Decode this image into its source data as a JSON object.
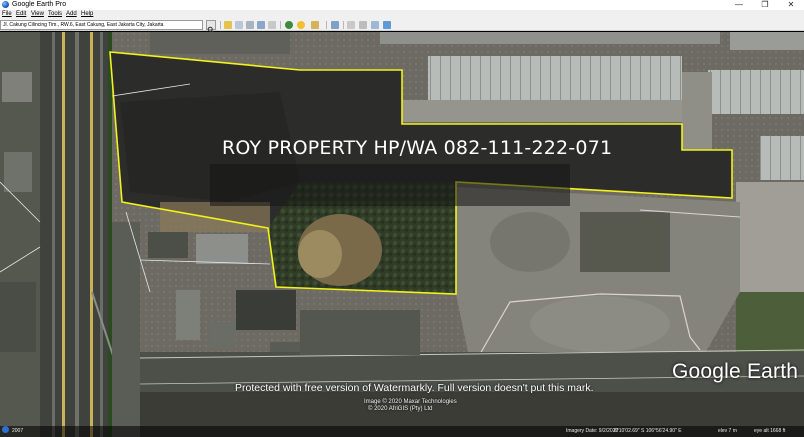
{
  "window": {
    "title": "Google Earth Pro",
    "minimize_glyph": "—",
    "maximize_glyph": "❐",
    "close_glyph": "✕"
  },
  "menu": {
    "items": [
      "File",
      "Edit",
      "View",
      "Tools",
      "Add",
      "Help"
    ]
  },
  "search": {
    "value": "Jl. Cakung Cilincing Tim., RW.6, East Cakung, East Jakarta City, Jakarta"
  },
  "toolbar": {
    "icons": [
      "search-icon",
      "sidebar-icon",
      "placemark-icon",
      "polygon-icon",
      "path-icon",
      "overlay-icon",
      "record-tour-icon",
      "historical-imagery-icon",
      "sun-icon",
      "planets-icon",
      "ruler-icon",
      "email-icon",
      "print-icon",
      "save-image-icon",
      "maps-icon"
    ]
  },
  "map": {
    "overlay_text": "ROY PROPERTY HP/WA 082-111-222-071",
    "boundary_color": "#f2f21c",
    "copyright_lines": [
      "Image © 2020 Maxar Technologies",
      "© 2020 AfriGIS (Pty) Ltd"
    ],
    "free_version_note": "Protected with free version of Watermarkly. Full version doesn't put this mark.",
    "logo_text": "Google Earth"
  },
  "status": {
    "year": "2007",
    "imagery_date": "Imagery Date: 9/2/2020",
    "coordinates": "6°10'02.69\" S  106°56'24.90\" E",
    "elevation": "elev  7 m",
    "eye_alt": "eye alt  1668 ft"
  }
}
